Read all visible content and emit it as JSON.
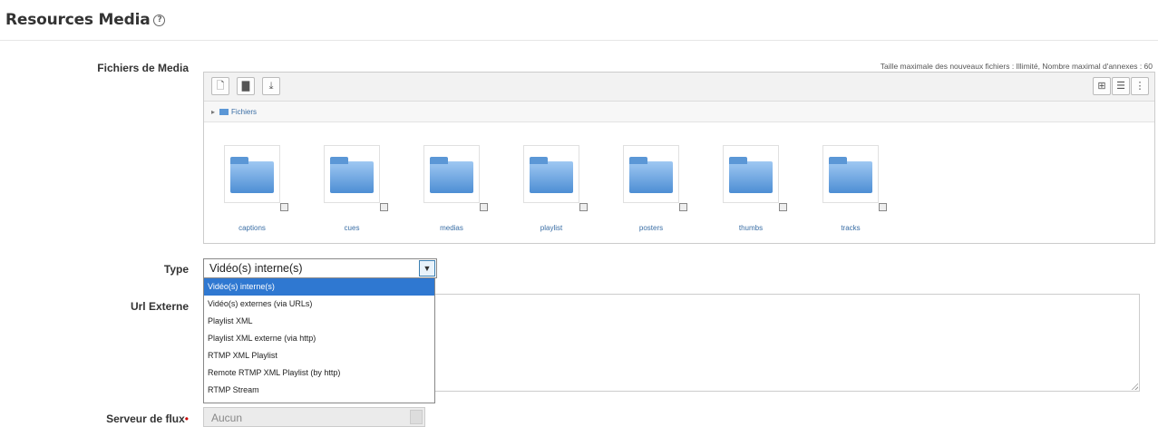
{
  "section": {
    "title": "Resources Media"
  },
  "filepicker": {
    "label": "Fichiers de Media",
    "info": "Taille maximale des nouveaux fichiers : Illimité, Nombre maximal d'annexes : 60",
    "path": "Fichiers",
    "folders": [
      "captions",
      "cues",
      "medias",
      "playlist",
      "posters",
      "thumbs",
      "tracks"
    ]
  },
  "type_field": {
    "label": "Type",
    "value": "Vidéo(s) interne(s)",
    "options": [
      "Vidéo(s) interne(s)",
      "Vidéo(s) externes (via URLs)",
      "Playlist XML",
      "Playlist XML externe (via http)",
      "RTMP XML Playlist",
      "Remote RTMP XML Playlist (by http)",
      "RTMP Stream"
    ]
  },
  "url_field": {
    "label": "Url Externe"
  },
  "stream_field": {
    "label": "Serveur de flux",
    "value": "Aucun"
  },
  "colors": {
    "selected": "#2f78d1",
    "link": "#3a6ea5"
  }
}
